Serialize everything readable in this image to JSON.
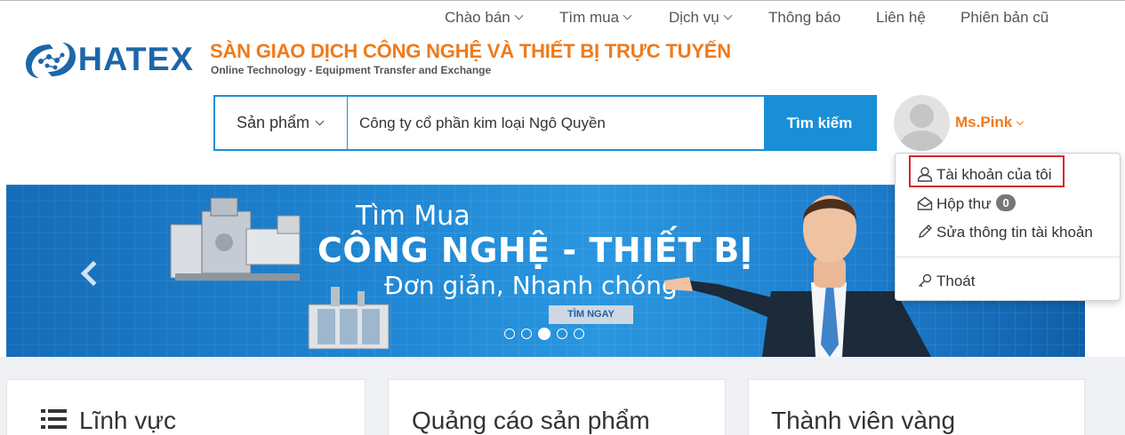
{
  "topnav": {
    "items": [
      {
        "label": "Chào bán",
        "has_dropdown": true
      },
      {
        "label": "Tìm mua",
        "has_dropdown": true
      },
      {
        "label": "Dịch vụ",
        "has_dropdown": true
      },
      {
        "label": "Thông báo",
        "has_dropdown": false
      },
      {
        "label": "Liên hệ",
        "has_dropdown": false
      },
      {
        "label": "Phiên bản cũ",
        "has_dropdown": false
      }
    ]
  },
  "brand": {
    "logo_text": "HATEX",
    "tagline_vn": "SÀN GIAO DỊCH CÔNG NGHỆ VÀ THIẾT BỊ TRỰC TUYẾN",
    "tagline_en": "Online Technology - Equipment Transfer and Exchange",
    "logo_color": "#1d66a9",
    "accent_color": "#f07a1a"
  },
  "search": {
    "category_label": "Sản phẩm",
    "query_value": "Công ty cổ phần kim loại Ngô Quyền",
    "button_label": "Tìm kiếm",
    "color": "#1b8fd6"
  },
  "user": {
    "name": "Ms.Pink",
    "menu": {
      "my_account": "Tài khoản của tôi",
      "inbox": "Hộp thư",
      "inbox_count": "0",
      "edit_account": "Sửa thông tin tài khoản",
      "logout": "Thoát"
    }
  },
  "banner": {
    "line1": "Tìm Mua",
    "line2": "CÔNG NGHỆ - THIẾT BỊ",
    "line3": "Đơn giản, Nhanh chóng",
    "cta": "TÌM NGAY",
    "slide_count": 5,
    "active_slide": 3
  },
  "panels": {
    "field_title": "Lĩnh vực",
    "ads_title": "Quảng cáo sản phẩm",
    "gold_members_title": "Thành viên vàng"
  }
}
